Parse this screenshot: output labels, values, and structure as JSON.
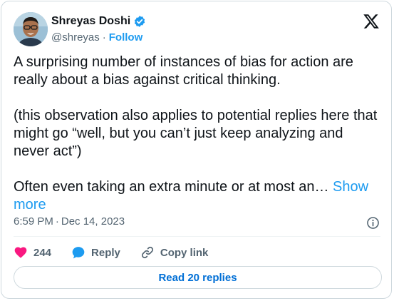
{
  "author": {
    "name": "Shreyas Doshi",
    "handle": "@shreyas",
    "separator": "·",
    "follow_label": "Follow"
  },
  "tweet": {
    "paragraphs": [
      "A surprising number of instances of bias for action are really about a bias against critical thinking.",
      "(this observation also applies to potential replies here that might go “well, but you can’t just keep analyzing and never act”)",
      "Often even taking an extra minute or at most an…"
    ],
    "show_more_label": "Show more"
  },
  "meta": {
    "time": "6:59 PM",
    "separator": "·",
    "date": "Dec 14, 2023"
  },
  "actions": {
    "likes_count": "244",
    "reply_label": "Reply",
    "copy_link_label": "Copy link"
  },
  "read_replies_label": "Read 20 replies",
  "colors": {
    "accent": "#1d9bf0",
    "like": "#f91880",
    "text": "#0f1419",
    "secondary": "#536471",
    "border": "#cfd9de"
  },
  "icons": {
    "verified": "verified-badge-icon",
    "brand": "x-logo-icon",
    "info": "info-icon",
    "like": "heart-icon",
    "reply": "speech-bubble-icon",
    "copy_link": "link-icon"
  }
}
